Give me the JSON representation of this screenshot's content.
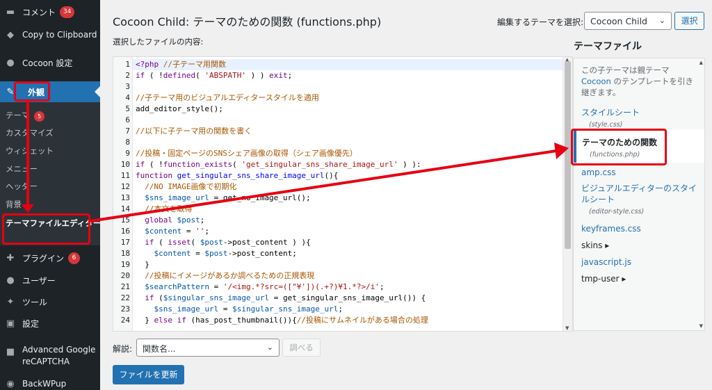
{
  "sidebar": {
    "comments_label": "コメント",
    "comments_count": "34",
    "copy_label": "Copy to Clipboard",
    "cocoon_label": "Cocoon 設定",
    "appearance_label": "外観",
    "submenu": [
      {
        "label": "テーマ",
        "badge": "5"
      },
      {
        "label": "カスタマイズ"
      },
      {
        "label": "ウィジェット"
      },
      {
        "label": "メニュー"
      },
      {
        "label": "ヘッダー"
      },
      {
        "label": "背景"
      }
    ],
    "editor_label": "テーマファイルエディター",
    "plugins_label": "プラグイン",
    "plugins_count": "6",
    "users_label": "ユーザー",
    "tools_label": "ツール",
    "settings_label": "設定",
    "recaptcha_label": "Advanced Google reCAPTCHA",
    "backwpup_label": "BackWPup"
  },
  "header": {
    "title": "Cocoon Child: テーマのための関数 (functions.php)",
    "select_theme_label": "編集するテーマを選択:",
    "theme_selected": "Cocoon Child",
    "select_button": "選択"
  },
  "editor": {
    "content_label": "選択したファイルの内容:",
    "lines": [
      {
        "n": "1",
        "html": "<span class='kw'>&lt;?php</span> <span class='cm'>//子テーマ用関数</span>"
      },
      {
        "n": "2",
        "html": "<span class='kw'>if</span> ( !<span class='kw'>defined</span>( <span class='st'>'ABSPATH'</span> ) ) <span class='kw'>exit</span>;"
      },
      {
        "n": "3",
        "html": ""
      },
      {
        "n": "4",
        "html": "<span class='cm'>//子テーマ用のビジュアルエディタースタイルを適用</span>"
      },
      {
        "n": "5",
        "html": "add_editor_style();"
      },
      {
        "n": "6",
        "html": ""
      },
      {
        "n": "7",
        "html": "<span class='cm'>//以下に子テーマ用の関数を書く</span>"
      },
      {
        "n": "8",
        "html": ""
      },
      {
        "n": "9",
        "html": "<span class='cm'>//投稿・固定ページのSNSシェア画像の取得（シェア画像優先）</span>"
      },
      {
        "n": "10",
        "html": "<span class='kw'>if</span> ( !<span class='kw'>function_exists</span>( <span class='st'>'get_singular_sns_share_image_url'</span> ) ):"
      },
      {
        "n": "11",
        "html": "<span class='kw'>function</span> <span class='df'>get_singular_sns_share_image_url</span>(){"
      },
      {
        "n": "12",
        "html": "  <span class='cm'>//NO IMAGE画像で初期化</span>"
      },
      {
        "n": "13",
        "html": "  <span class='vr'>$sns_image_url</span> = get_no_image_url();"
      },
      {
        "n": "14",
        "html": "  <span class='cm'>//本文を取得</span>"
      },
      {
        "n": "15",
        "html": "  <span class='kw'>global</span> <span class='vr'>$post</span>;"
      },
      {
        "n": "16",
        "html": "  <span class='vr'>$content</span> = <span class='st'>''</span>;"
      },
      {
        "n": "17",
        "html": "  <span class='kw'>if</span> ( <span class='kw'>isset</span>( <span class='vr'>$post</span>-&gt;post_content ) ){"
      },
      {
        "n": "18",
        "html": "    <span class='vr'>$content</span> = <span class='vr'>$post</span>-&gt;post_content;"
      },
      {
        "n": "19",
        "html": "  }"
      },
      {
        "n": "20",
        "html": "  <span class='cm'>//投稿にイメージがあるか調べるための正規表現</span>"
      },
      {
        "n": "21",
        "html": "  <span class='vr'>$searchPattern</span> = <span class='st'>'/&lt;img.*?src=([\"¥'])(.+?)¥1.*?&gt;/i'</span>;"
      },
      {
        "n": "22",
        "html": "  <span class='kw'>if</span> (<span class='vr'>$singular_sns_image_url</span> = get_singular_sns_image_url()) {"
      },
      {
        "n": "23",
        "html": "    <span class='vr'>$sns_image_url</span> = <span class='vr'>$singular_sns_image_url</span>;"
      },
      {
        "n": "24",
        "html": "  } <span class='kw'>else if</span> (has_post_thumbnail()){<span class='cm'>//投稿にサムネイルがある場合の処理</span>"
      }
    ]
  },
  "footer": {
    "doc_label": "解説:",
    "doc_placeholder": "関数名...",
    "lookup_button": "調べる",
    "update_button": "ファイルを更新"
  },
  "theme_files": {
    "title": "テーマファイル",
    "note_pre": "この子テーマは親テーマ ",
    "note_link": "Cocoon",
    "note_post": " のテンプレートを引き継ぎます。",
    "stylesheet": "スタイルシート",
    "stylesheet_sub": "(style.css)",
    "functions": "テーマのための関数",
    "functions_sub": "(functions.php)",
    "amp": "amp.css",
    "visual_editor": "ビジュアルエディターのスタイルシート",
    "visual_editor_sub": "(editor-style.css)",
    "keyframes": "keyframes.css",
    "skins": "skins ▸",
    "javascript": "javascript.js",
    "tmp_user": "tmp-user ▸"
  }
}
